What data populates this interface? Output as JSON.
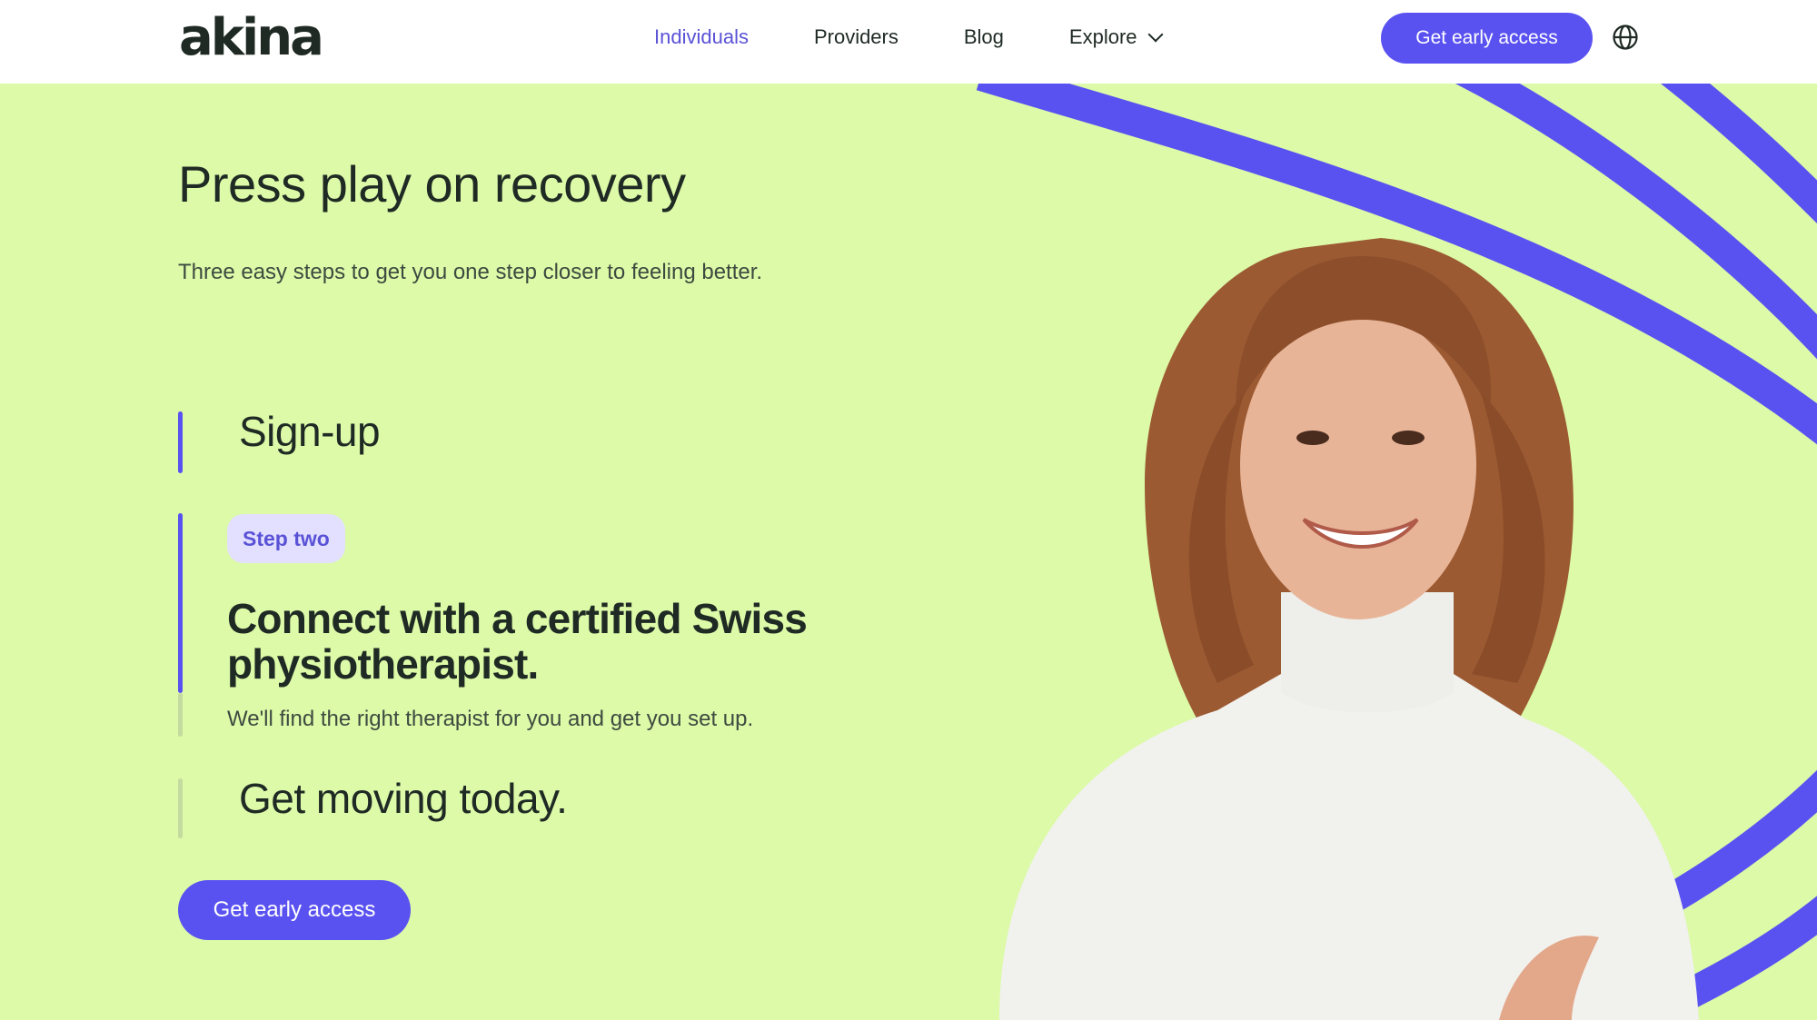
{
  "header": {
    "logo": "akina",
    "nav": [
      {
        "label": "Individuals",
        "active": true
      },
      {
        "label": "Providers",
        "active": false
      },
      {
        "label": "Blog",
        "active": false
      },
      {
        "label": "Explore",
        "active": false,
        "has_dropdown": true
      }
    ],
    "cta_label": "Get early access",
    "globe_icon": "globe-icon"
  },
  "hero": {
    "title": "Press play on recovery",
    "subtitle": "Three easy steps to get you one step closer to feeling better.",
    "steps": [
      {
        "title": "Sign-up"
      },
      {
        "badge": "Step two",
        "title": "Connect with a certified Swiss physiotherapist.",
        "description": "We'll find the right therapist for you and get you set up."
      },
      {
        "title": "Get moving today."
      }
    ],
    "cta_label": "Get early access",
    "image_icon": "smiling-woman-portrait"
  },
  "colors": {
    "background": "#dcfaa8",
    "accent": "#5a52f0",
    "accent_text": "#5a52d6",
    "badge_bg": "#e3e0ff",
    "text": "#1f2a24"
  }
}
